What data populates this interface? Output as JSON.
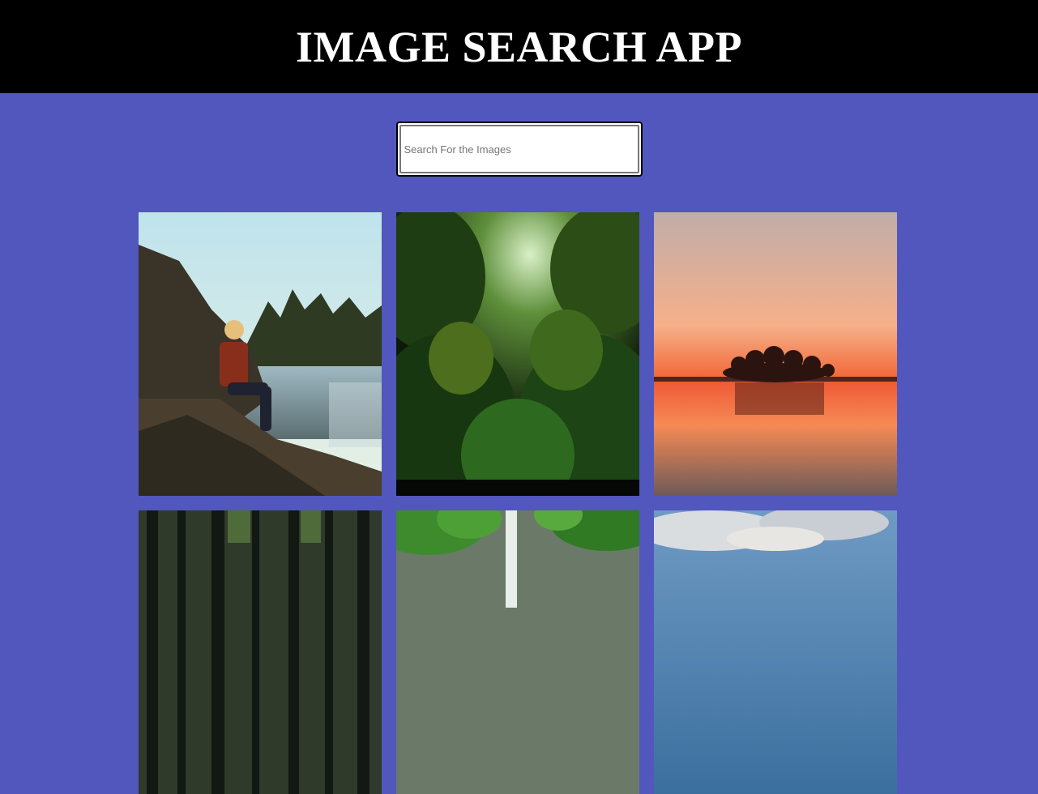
{
  "header": {
    "title": "IMAGE SEARCH APP"
  },
  "search": {
    "placeholder": "Search For the Images",
    "value": ""
  },
  "results": [
    {
      "icon": "photo-woman-by-river"
    },
    {
      "icon": "photo-green-forest"
    },
    {
      "icon": "photo-sunset-island-lake"
    },
    {
      "icon": "photo-forest-trees"
    },
    {
      "icon": "photo-waterfall-trees"
    },
    {
      "icon": "photo-cloudy-sky"
    }
  ],
  "colors": {
    "background": "#5157bd",
    "header": "#000000",
    "title": "#ffffff"
  }
}
